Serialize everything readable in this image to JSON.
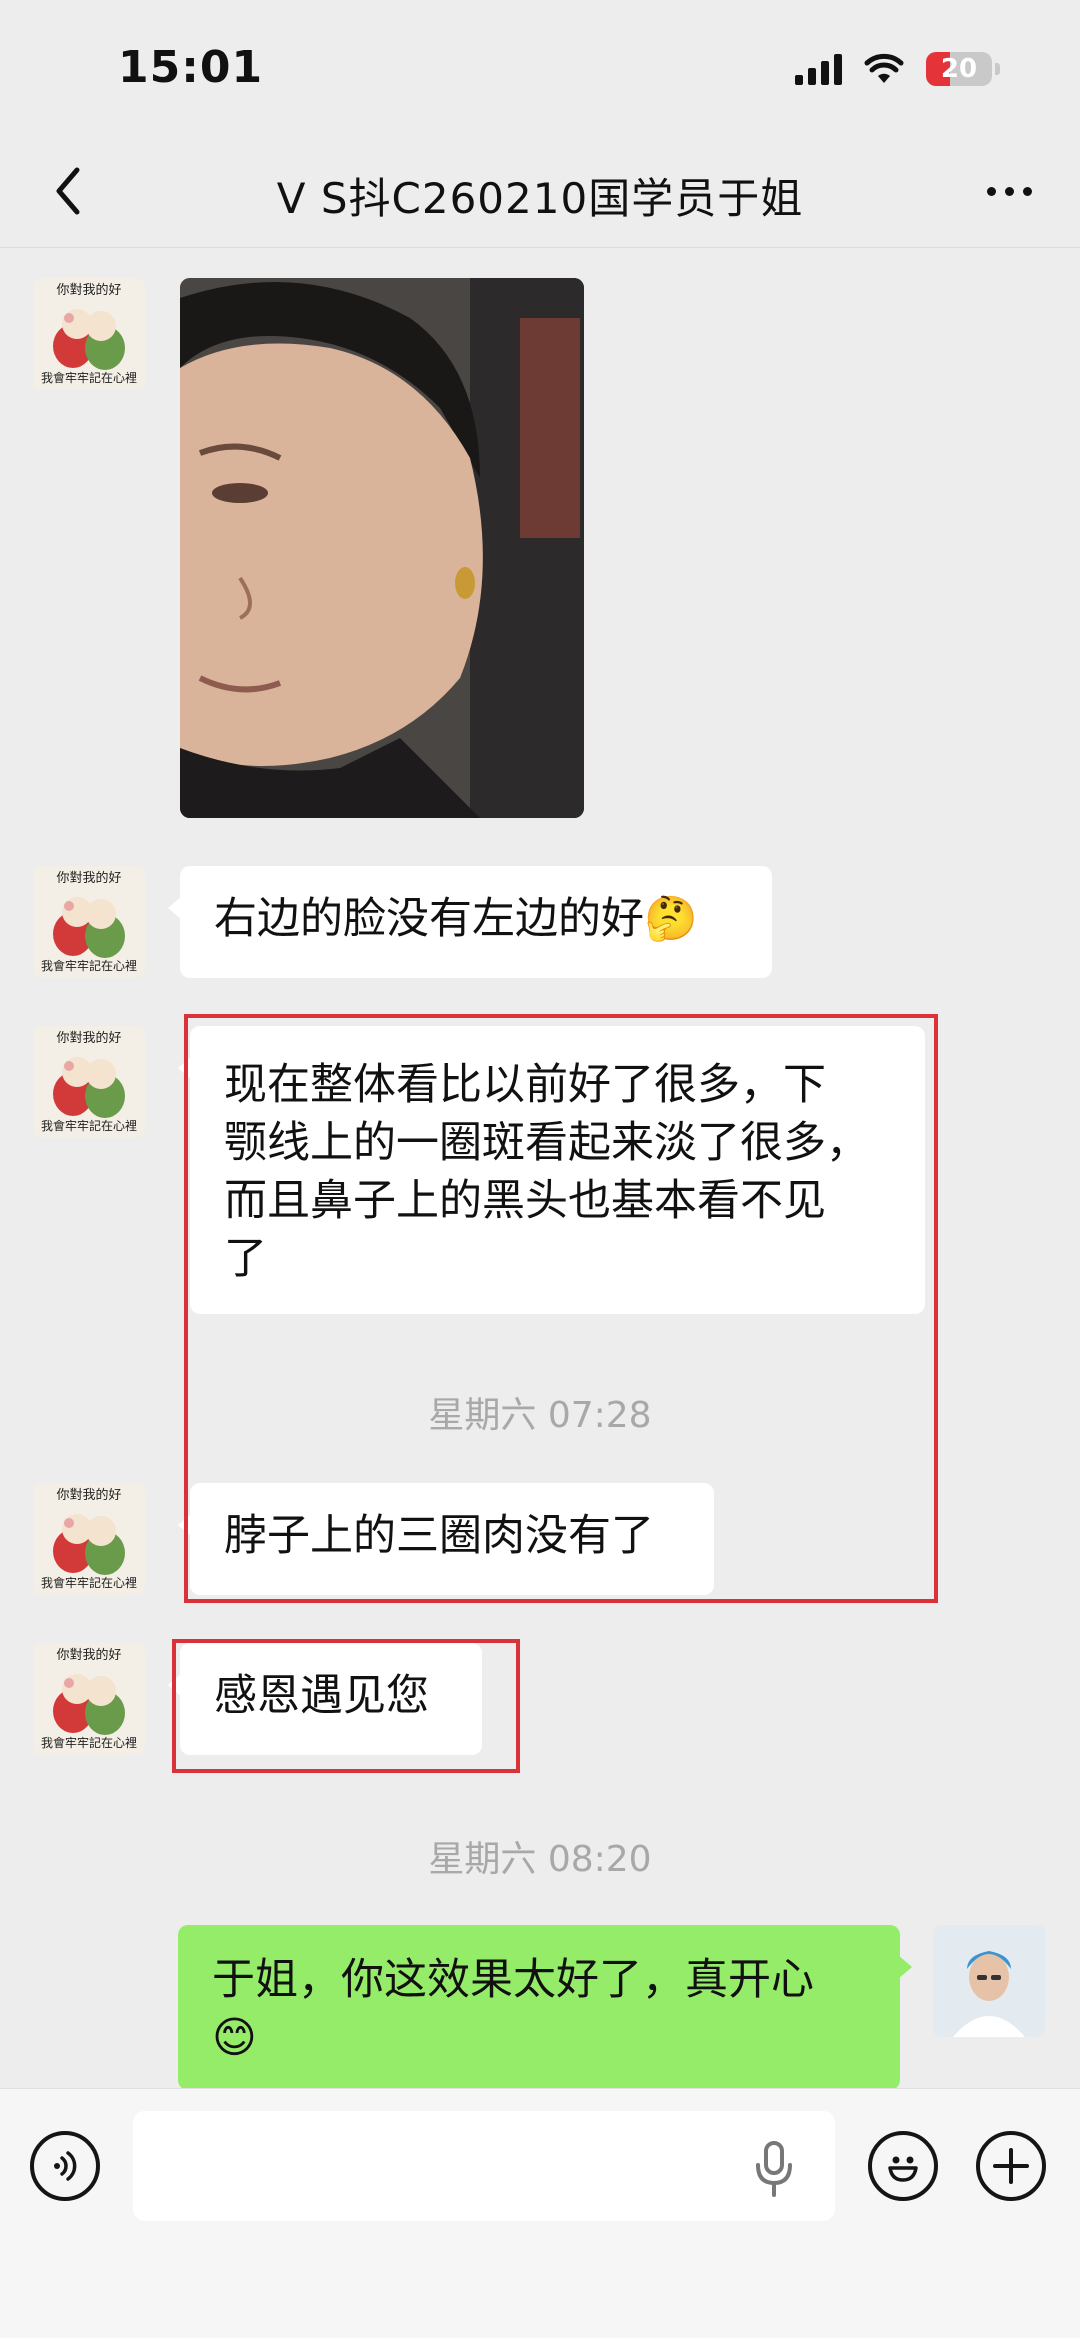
{
  "status_bar": {
    "time": "15:01",
    "battery_level": "20",
    "battery_color": "#e5333a",
    "icons": [
      "signal-icon",
      "wifi-icon",
      "battery-icon"
    ]
  },
  "header": {
    "title": "V S抖C260210国学员于姐",
    "back_icon": "chevron-left-icon",
    "more_icon": "more-dots-icon"
  },
  "avatar_text": {
    "top": "你對我的好",
    "bottom": "我會牢牢記在心裡"
  },
  "messages": [
    {
      "type": "image",
      "sender": "other"
    },
    {
      "type": "text",
      "sender": "other",
      "text": "右边的脸没有左边的好🤔"
    },
    {
      "type": "text",
      "sender": "other",
      "lines": [
        "现在整体看比以前好了很多，下",
        "颚线上的一圈斑看起来淡了很多，",
        "而且鼻子上的黑头也基本看不见",
        "了"
      ]
    },
    {
      "type": "timestamp",
      "text": "星期六 07:28"
    },
    {
      "type": "text",
      "sender": "other",
      "text": "脖子上的三圈肉没有了"
    },
    {
      "type": "text",
      "sender": "other",
      "text": "感恩遇见您"
    },
    {
      "type": "timestamp",
      "text": "星期六 08:20"
    },
    {
      "type": "text",
      "sender": "me",
      "lines": [
        "于姐，你这效果太好了，真开心",
        "😊"
      ]
    }
  ],
  "colors": {
    "background": "#ededed",
    "own_bubble": "#95ec69",
    "other_bubble": "#ffffff",
    "highlight": "#d9323a"
  },
  "input_bar": {
    "placeholder": "",
    "icons": [
      "voice-icon",
      "microphone-icon",
      "emoji-icon",
      "plus-icon"
    ]
  }
}
